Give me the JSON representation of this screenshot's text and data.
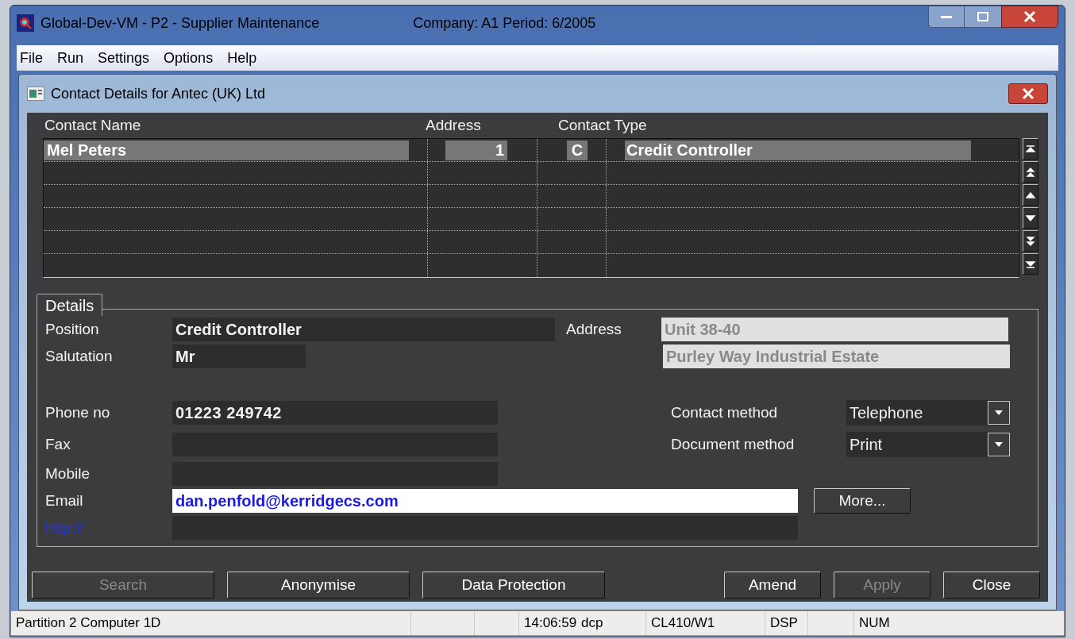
{
  "window": {
    "title": "Global-Dev-VM - P2 - Supplier Maintenance",
    "context": "Company: A1  Period:  6/2005"
  },
  "menu": [
    "File",
    "Run",
    "Settings",
    "Options",
    "Help"
  ],
  "dialog": {
    "title": "Contact Details for Antec (UK) Ltd"
  },
  "table": {
    "columns": [
      "Contact Name",
      "Address",
      "Contact Type"
    ],
    "rows": [
      {
        "name": "Mel Peters",
        "address": "1",
        "type_code": "C",
        "type": "Credit Controller",
        "selected": true
      }
    ]
  },
  "details": {
    "tab": "Details",
    "position": {
      "label": "Position",
      "value": "Credit Controller"
    },
    "salutation": {
      "label": "Salutation",
      "value": "Mr"
    },
    "address": {
      "label": "Address",
      "lines": [
        "Unit 38-40",
        "Purley Way Industrial Estate"
      ]
    },
    "phone": {
      "label": "Phone no",
      "value": "01223 249742"
    },
    "fax": {
      "label": "Fax"
    },
    "mobile": {
      "label": "Mobile"
    },
    "email": {
      "label": "Email",
      "value": "dan.penfold@kerridgecs.com",
      "focused": true
    },
    "web": {
      "label": "http://"
    },
    "contact_method": {
      "label": "Contact method",
      "value": "Telephone"
    },
    "document_method": {
      "label": "Document method",
      "value": "Print"
    },
    "more_button": "More..."
  },
  "left_buttons": [
    {
      "label": "Search",
      "disabled": true
    },
    {
      "label": "Anonymise",
      "disabled": false
    },
    {
      "label": "Data Protection",
      "disabled": false
    }
  ],
  "right_buttons": [
    {
      "label": "Amend",
      "disabled": false
    },
    {
      "label": "Apply",
      "disabled": true
    },
    {
      "label": "Close",
      "disabled": false
    }
  ],
  "status_bar": [
    "Partition 2 Computer 1D",
    "14:06:59",
    "dcp",
    "CL410/W1",
    "DSP",
    "NUM"
  ]
}
